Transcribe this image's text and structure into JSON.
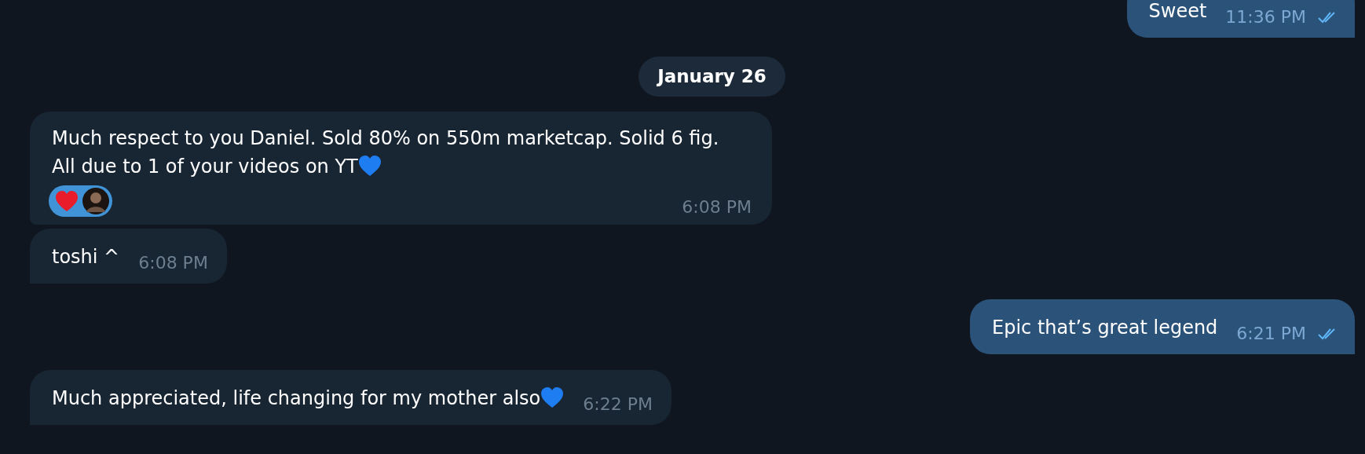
{
  "messages": [
    {
      "kind": "outgoing",
      "text": "Sweet",
      "time": "11:36 PM",
      "read": true
    },
    {
      "kind": "date",
      "text": "January 26"
    },
    {
      "kind": "incoming",
      "text": "Much respect to you Daniel. Sold 80% on 550m marketcap. Solid 6 fig. All due to 1 of your videos on YT",
      "heart": true,
      "reactions": [
        {
          "kind": "heart",
          "selected": true
        }
      ],
      "time": "6:08 PM"
    },
    {
      "kind": "incoming",
      "text": "toshi ^",
      "time": "6:08 PM"
    },
    {
      "kind": "outgoing",
      "text": "Epic that’s great legend",
      "time": "6:21 PM",
      "read": true
    },
    {
      "kind": "incoming",
      "text": "Much appreciated, life changing for my mother also",
      "heart": true,
      "time": "6:22 PM"
    }
  ]
}
